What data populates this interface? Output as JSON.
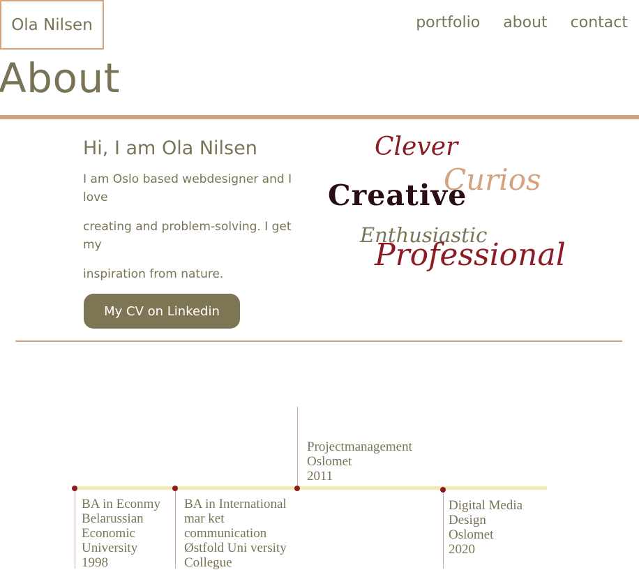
{
  "header": {
    "logo": "Ola Nilsen",
    "nav": [
      {
        "label": "portfolio"
      },
      {
        "label": "about"
      },
      {
        "label": "contact"
      }
    ]
  },
  "page": {
    "title": "About"
  },
  "intro": {
    "greeting": "Hi, I am Ola Nilsen",
    "bio": [
      "I am Oslo based webdesigner and I love",
      "creating and problem-solving. I get my",
      "inspiration from nature."
    ],
    "cv_button": "My CV on Linkedin"
  },
  "words": {
    "clever": "Clever",
    "curios": "Curios",
    "creative": "Creative",
    "enthusiastic": "Enthusiastic",
    "professional": "Professional"
  },
  "timeline": [
    {
      "lines": [
        "BA in Econmy",
        "Belarussian",
        "Economic",
        "University",
        "1998"
      ]
    },
    {
      "lines": [
        "BA in International",
        "mar ket",
        "communication",
        "Østfold Uni versity",
        "Collegue"
      ]
    },
    {
      "lines": [
        "Projectmanagement",
        "Oslomet",
        "2011"
      ]
    },
    {
      "lines": [
        "Digital Media",
        "Design",
        "Oslomet",
        "2020"
      ]
    }
  ],
  "colors": {
    "accent": "#d5a27f",
    "text": "#7a7457",
    "button": "#7e7555",
    "dark_red": "#8b1c24",
    "timeline_line": "#f6e9b0"
  }
}
